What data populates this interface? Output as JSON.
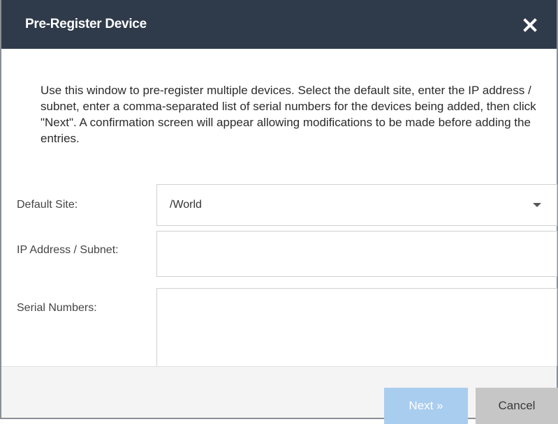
{
  "dialog": {
    "title": "Pre-Register Device",
    "close_icon": "close-icon",
    "intro_text": "Use this window to pre-register multiple devices. Select the default site, enter the IP address / subnet, enter a comma-separated list of serial numbers for the devices being added, then click \"Next\". A confirmation screen will appear allowing modifications to be made before adding the entries."
  },
  "form": {
    "default_site_label": "Default Site:",
    "default_site_value": "/World",
    "ip_label": "IP Address / Subnet:",
    "ip_value": "",
    "serial_label": "Serial Numbers:",
    "serial_value": ""
  },
  "footer": {
    "next_label": "Next »",
    "cancel_label": "Cancel"
  },
  "colors": {
    "titlebar": "#2f3a4a",
    "next_button": "#a9cdef",
    "cancel_button": "#c6c6c6"
  }
}
